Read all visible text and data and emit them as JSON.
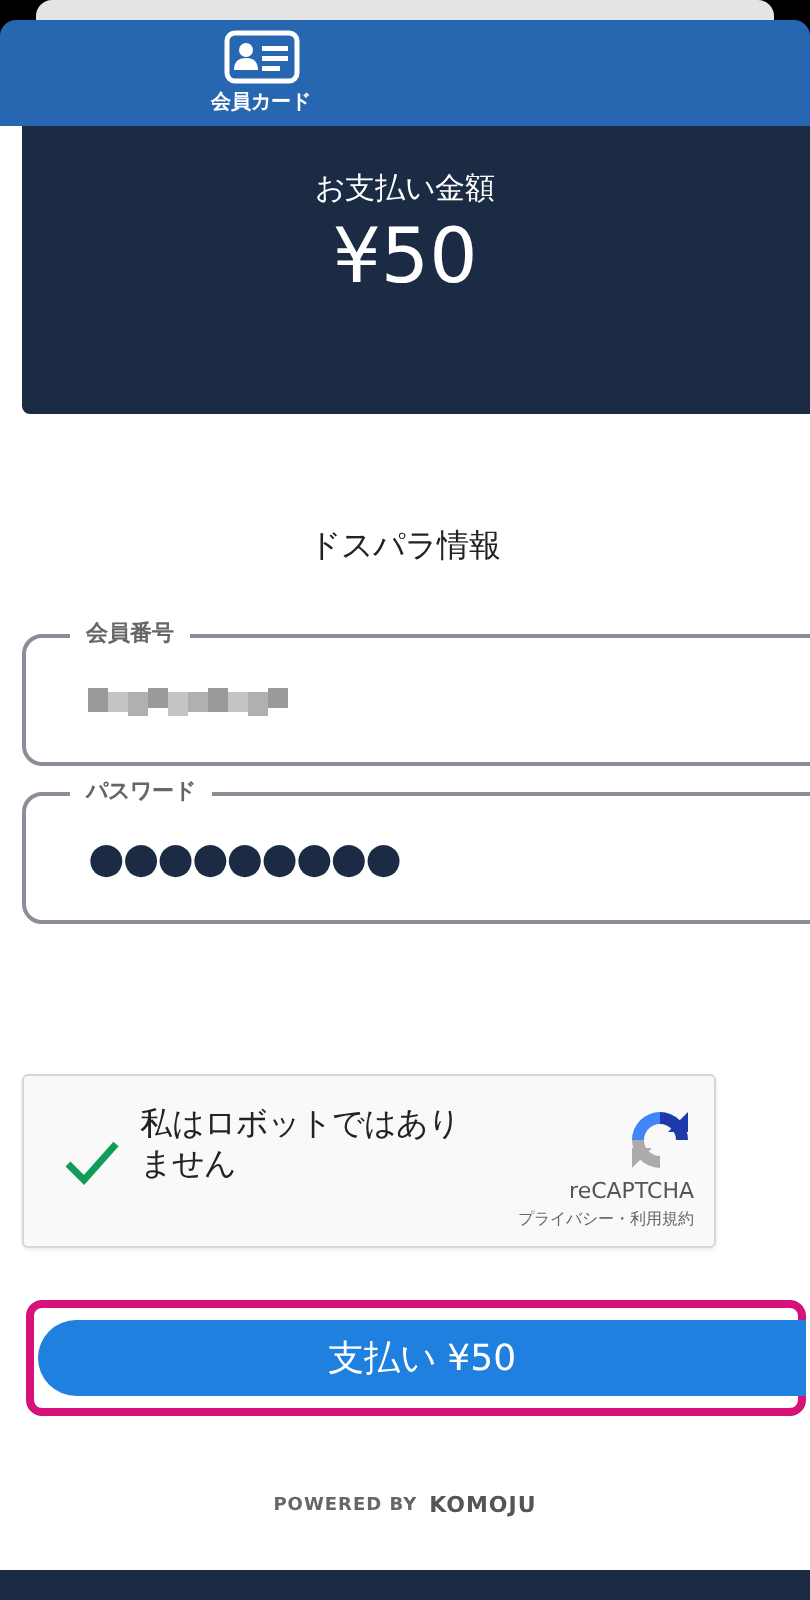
{
  "tab": {
    "label": "会員カード",
    "selected": true
  },
  "amount_panel": {
    "label": "お支払い金額",
    "amount": "¥50"
  },
  "section_title": "ドスパラ情報",
  "fields": [
    {
      "label": "会員番号",
      "kind": "blurred"
    },
    {
      "label": "パスワード",
      "kind": "password",
      "value": "●●●●●●●●●"
    }
  ],
  "captcha": {
    "checked": true,
    "label": "私はロボットではありません",
    "brand": "reCAPTCHA",
    "links": "プライバシー・利用規約"
  },
  "pay_button": {
    "label": "支払い ¥50",
    "highlighted": true
  },
  "powered_by": {
    "prefix": "POWERED BY",
    "brand": "KOMOJU"
  }
}
